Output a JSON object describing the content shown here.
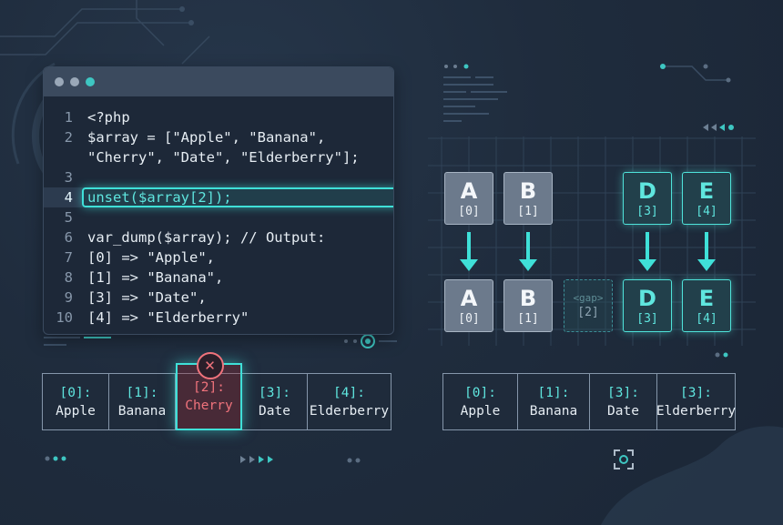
{
  "code_window": {
    "lines": [
      {
        "num": "1",
        "text": "<?php"
      },
      {
        "num": "2",
        "text": "$array = [\"Apple\", \"Banana\","
      },
      {
        "num": "",
        "text": "\"Cherry\", \"Date\", \"Elderberry\"];"
      },
      {
        "num": "3",
        "text": ""
      },
      {
        "num": "4",
        "text": "unset($array[2]);",
        "highlight": true
      },
      {
        "num": "5",
        "text": ""
      },
      {
        "num": "6",
        "text": "var_dump($array); // Output:"
      },
      {
        "num": "7",
        "text": "[0] => \"Apple\","
      },
      {
        "num": "8",
        "text": "[1] => \"Banana\","
      },
      {
        "num": "9",
        "text": "[3] => \"Date\","
      },
      {
        "num": "10",
        "text": "[4] => \"Elderberry\""
      }
    ]
  },
  "before_array": [
    {
      "idx": "[0]:",
      "val": "Apple"
    },
    {
      "idx": "[1]:",
      "val": "Banana"
    },
    {
      "idx": "[2]:",
      "val": "Cherry",
      "removed": true
    },
    {
      "idx": "[3]:",
      "val": "Date"
    },
    {
      "idx": "[4]:",
      "val": "Elderberry"
    }
  ],
  "after_array": [
    {
      "idx": "[0]:",
      "val": "Apple"
    },
    {
      "idx": "[1]:",
      "val": "Banana"
    },
    {
      "idx": "[3]:",
      "val": "Date"
    },
    {
      "idx": "[3]:",
      "val": "Elderberry"
    }
  ],
  "grid": {
    "top_row": [
      {
        "letter": "A",
        "index": "[0]"
      },
      {
        "letter": "B",
        "index": "[1]"
      },
      {
        "letter": "D",
        "index": "[3]"
      },
      {
        "letter": "E",
        "index": "[4]"
      }
    ],
    "bottom_row": [
      {
        "letter": "A",
        "index": "[0]"
      },
      {
        "letter": "B",
        "index": "[1]"
      },
      {
        "gap_label": "<gap>",
        "index": "[2]"
      },
      {
        "letter": "D",
        "index": "[3]"
      },
      {
        "letter": "E",
        "index": "[4]"
      }
    ]
  },
  "colors": {
    "accent": "#3fe0d8",
    "removed": "#f0737c",
    "background": "#1f2c3d"
  },
  "icons": {
    "remove": "close-icon",
    "focus": "focus-frame-icon"
  }
}
